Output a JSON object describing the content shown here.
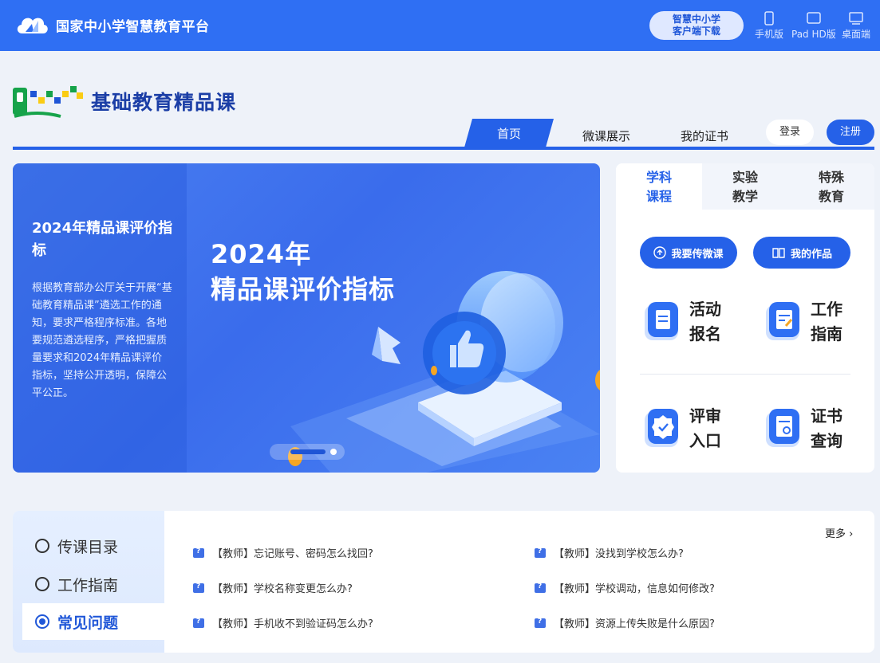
{
  "topbar": {
    "brand": "国家中小学智慧教育平台",
    "download_line1": "智慧中小学",
    "download_line2": "客户端下载",
    "devices": [
      {
        "label": "手机版",
        "icon": "phone-icon"
      },
      {
        "label": "Pad HD版",
        "icon": "tablet-icon"
      },
      {
        "label": "桌面端",
        "icon": "desktop-icon"
      }
    ]
  },
  "header": {
    "logo_title": "基础教育精品课",
    "nav": [
      "首页",
      "微课展示",
      "我的证书"
    ],
    "login": "登录",
    "register": "注册"
  },
  "banner": {
    "left_title": "2024年精品课评价指标",
    "left_text": "根据教育部办公厅关于开展“基础教育精品课”遴选工作的通知，要求严格程序标准。各地要规范遴选程序，严格把握质量要求和2024年精品课评价指标，坚持公开透明，保障公平公正。",
    "main_title_line1": "2024年",
    "main_title_line2": "精品课评价指标"
  },
  "panel": {
    "tabs": [
      "学科课程",
      "实验教学",
      "特殊教育"
    ],
    "active_tab": 0,
    "buttons": [
      {
        "label": "我要传微课",
        "icon": "upload-icon"
      },
      {
        "label": "我的作品",
        "icon": "book-icon"
      }
    ],
    "items": [
      {
        "label": "活动报名",
        "icon": "clipboard-icon"
      },
      {
        "label": "工作指南",
        "icon": "guide-icon"
      },
      {
        "label": "评审入口",
        "icon": "badge-icon"
      },
      {
        "label": "证书查询",
        "icon": "certificate-icon"
      }
    ]
  },
  "bottom": {
    "side": [
      "传课目录",
      "工作指南",
      "常见问题"
    ],
    "active_side": 2,
    "more": "更多 ›",
    "faqs": [
      "【教师】忘记账号、密码怎么找回?",
      "【教师】没找到学校怎么办?",
      "【教师】学校名称变更怎么办?",
      "【教师】学校调动，信息如何修改?",
      "【教师】手机收不到验证码怎么办?",
      "【教师】资源上传失败是什么原因?"
    ]
  },
  "colors": {
    "primary": "#2561e8",
    "topbar": "#2f6ff3"
  }
}
